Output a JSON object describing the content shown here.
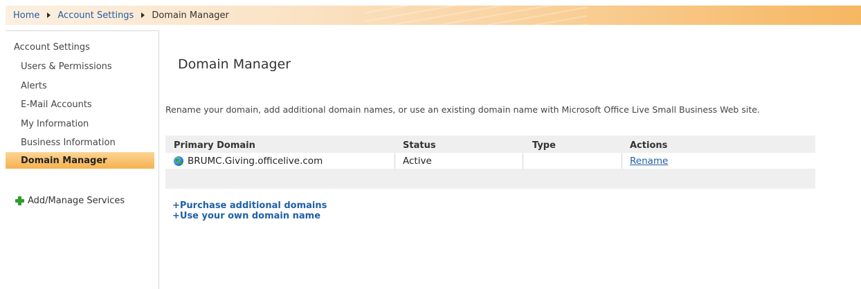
{
  "breadcrumb": {
    "items": [
      "Home",
      "Account Settings",
      "Domain Manager"
    ]
  },
  "sidebar": {
    "heading": "Account Settings",
    "items": [
      "Users & Permissions",
      "Alerts",
      "E-Mail Accounts",
      "My Information",
      "Business Information"
    ],
    "active": "Domain Manager",
    "add_services": "Add/Manage Services"
  },
  "main": {
    "title": "Domain Manager",
    "description": "Rename your domain, add additional domain names, or use an existing domain name with Microsoft Office Live Small Business Web site.",
    "table": {
      "headers": [
        "Primary Domain",
        "Status",
        "Type",
        "Actions"
      ],
      "rows": [
        {
          "domain": "BRUMC.Giving.officelive.com",
          "status": "Active",
          "type": "",
          "action": "Rename",
          "icon": "globe-icon"
        }
      ]
    },
    "links": [
      "+Purchase additional domains",
      "+Use your own domain name"
    ]
  },
  "colors": {
    "link": "#1f5fa6",
    "accent_orange": "#f7b14e",
    "add_icon_green": "#2e9b2b"
  }
}
